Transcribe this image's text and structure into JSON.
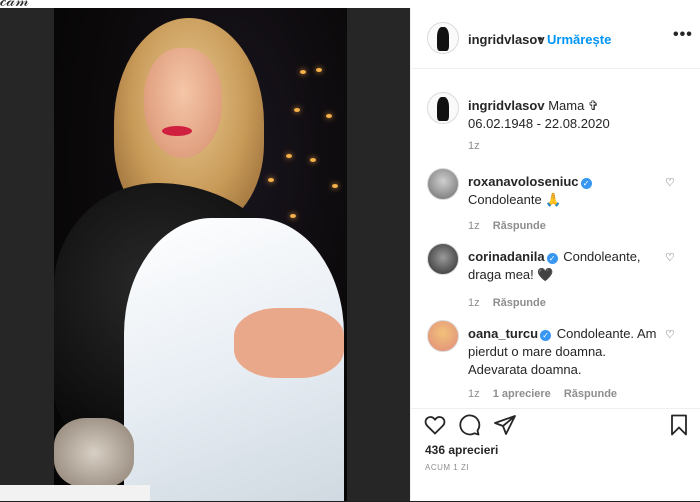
{
  "post": {
    "author": "ingridvlasov",
    "follow_label": "Urmărește",
    "caption": {
      "username": "ingridvlasov",
      "text": "Mama ✞",
      "dates": "06.02.1948 - 22.08.2020",
      "time": "1z"
    },
    "comments": [
      {
        "username": "roxanavoloseniuc",
        "verified": true,
        "text": "Condoleante 🙏",
        "time": "1z",
        "likes": "",
        "reply_label": "Răspunde"
      },
      {
        "username": "corinadanila",
        "verified": true,
        "text": "Condoleante, draga mea! 🖤",
        "time": "1z",
        "likes": "",
        "reply_label": "Răspunde"
      },
      {
        "username": "oana_turcu",
        "verified": true,
        "text": "Condoleante. Am pierdut o mare doamna. Adevarata doamna.",
        "time": "1z",
        "likes": "1 apreciere",
        "reply_label": "Răspunde"
      }
    ],
    "likes_count": "436 aprecieri",
    "posted_ago": "ACUM 1 ZI"
  },
  "icons": {
    "like": "heart-icon",
    "comment": "comment-icon",
    "share": "share-icon",
    "save": "bookmark-icon",
    "more": "more-options-icon",
    "verified": "verified-badge-icon"
  },
  "colors": {
    "follow_blue": "#0095f6",
    "verified_blue": "#3897f0",
    "muted": "#8e8e8e",
    "text": "#262626"
  }
}
